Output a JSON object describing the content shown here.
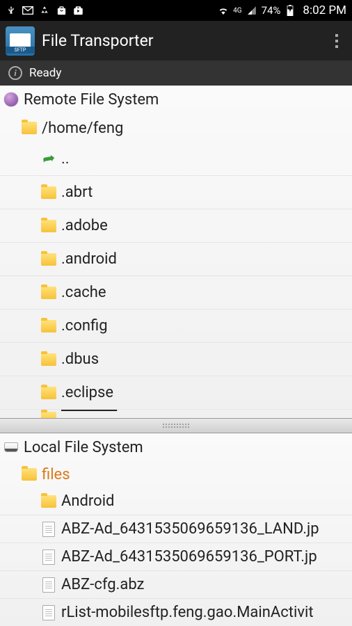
{
  "status_bar": {
    "battery_pct": "74%",
    "time": "8:02 PM",
    "network": "4G"
  },
  "app_bar": {
    "icon_label": "SFTP",
    "title": "File Transporter"
  },
  "status_row": {
    "text": "Ready"
  },
  "remote": {
    "title": "Remote File System",
    "path": "/home/feng",
    "up_label": "..",
    "entries": [
      {
        "name": ".abrt",
        "type": "folder"
      },
      {
        "name": ".adobe",
        "type": "folder"
      },
      {
        "name": ".android",
        "type": "folder"
      },
      {
        "name": ".cache",
        "type": "folder"
      },
      {
        "name": ".config",
        "type": "folder"
      },
      {
        "name": ".dbus",
        "type": "folder"
      },
      {
        "name": ".eclipse",
        "type": "folder"
      }
    ]
  },
  "local": {
    "title": "Local File System",
    "path": "files",
    "entries": [
      {
        "name": "Android",
        "type": "folder"
      },
      {
        "name": "ABZ-Ad_6431535069659136_LAND.jp",
        "type": "file"
      },
      {
        "name": "ABZ-Ad_6431535069659136_PORT.jp",
        "type": "file"
      },
      {
        "name": "ABZ-cfg.abz",
        "type": "file"
      },
      {
        "name": "rList-mobilesftp.feng.gao.MainActivit",
        "type": "file"
      }
    ]
  }
}
